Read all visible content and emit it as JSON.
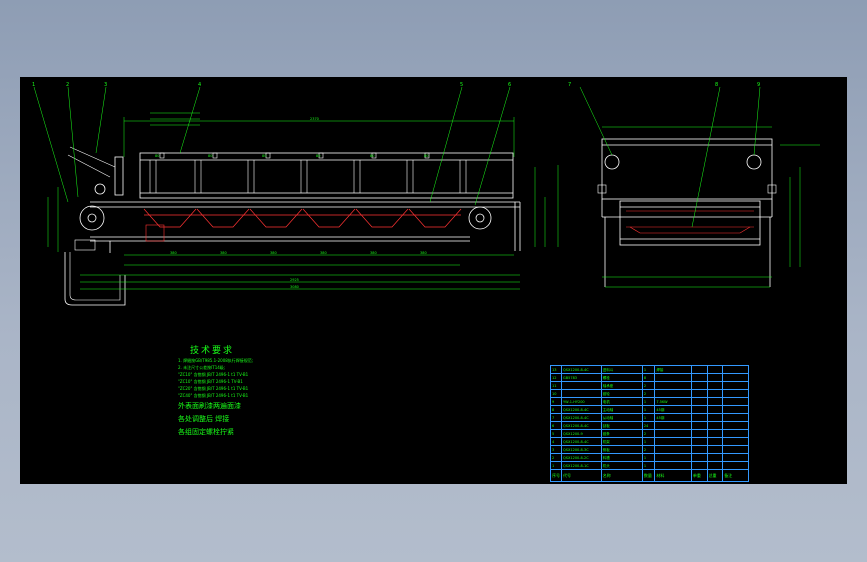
{
  "window": {
    "background_color": "#000000",
    "line_color": "#ffffff",
    "dimension_color": "#19ff19",
    "accent_color": "#ff2222"
  },
  "balloons": [
    "1",
    "2",
    "3",
    "4",
    "5",
    "6",
    "7",
    "8",
    "9"
  ],
  "notes": {
    "title": "技术要求",
    "lines": [
      "1. 焊缝按GB/T985.1-2008执行焊接规范;",
      "2. 未注尺寸公差按IT14级;",
      "\"ZC10\" 含铬钢 JB/T 2496-1 t1 TV-B1",
      "\"ZC10\" 含铬钢 JB/T 2496-1 TV-B1",
      "\"ZC20\" 含铬钢 JB/T 2496-1 t1 TV-B1",
      "\"ZC40\" 含铬钢 JB/T 2496-1 t1 TV-B1",
      "外表面刷漆两遍面漆",
      "各处调整后 焊接"
    ],
    "footer": "各组固定螺栓拧紧"
  },
  "bom": {
    "rows": [
      [
        "13",
        "QSX1200-8-4C",
        "进料斗",
        "1",
        "焊接",
        "",
        "",
        ""
      ],
      [
        "12",
        "GB5783",
        "螺栓",
        "8",
        "",
        "",
        "",
        ""
      ],
      [
        "11",
        "",
        "轴承座",
        "2",
        "",
        "",
        "",
        ""
      ],
      [
        "10",
        "",
        "链轮",
        "2",
        "",
        "",
        "",
        ""
      ],
      [
        "9",
        "YW-1-HY200",
        "电机",
        "1",
        "7.5KW",
        "",
        "",
        ""
      ],
      [
        "8",
        "QSX1200-8-4C",
        "主动轴",
        "1",
        "45钢",
        "",
        "",
        ""
      ],
      [
        "7",
        "QSX1200-8-4C",
        "从动轴",
        "1",
        "45钢",
        "",
        "",
        ""
      ],
      [
        "6",
        "QSX1200-8-4C",
        "刮板",
        "24",
        "",
        "",
        "",
        ""
      ],
      [
        "5",
        "QSX1200-9",
        "链条",
        "2",
        "",
        "",
        "",
        ""
      ],
      [
        "4",
        "QSX1200-8-4C",
        "机架",
        "1",
        "",
        "",
        "",
        ""
      ],
      [
        "3",
        "QSX1200-8-3C",
        "侧板",
        "2",
        "",
        "",
        "",
        ""
      ],
      [
        "2",
        "QSX1200-8-2C",
        "料槽",
        "1",
        "",
        "",
        "",
        ""
      ],
      [
        "1",
        "QSX1200-8-1C",
        "机头",
        "1",
        "",
        "",
        "",
        ""
      ]
    ],
    "header": [
      "序号",
      "代号",
      "名称",
      "数量",
      "材料",
      "单重",
      "总重",
      "备注"
    ]
  }
}
